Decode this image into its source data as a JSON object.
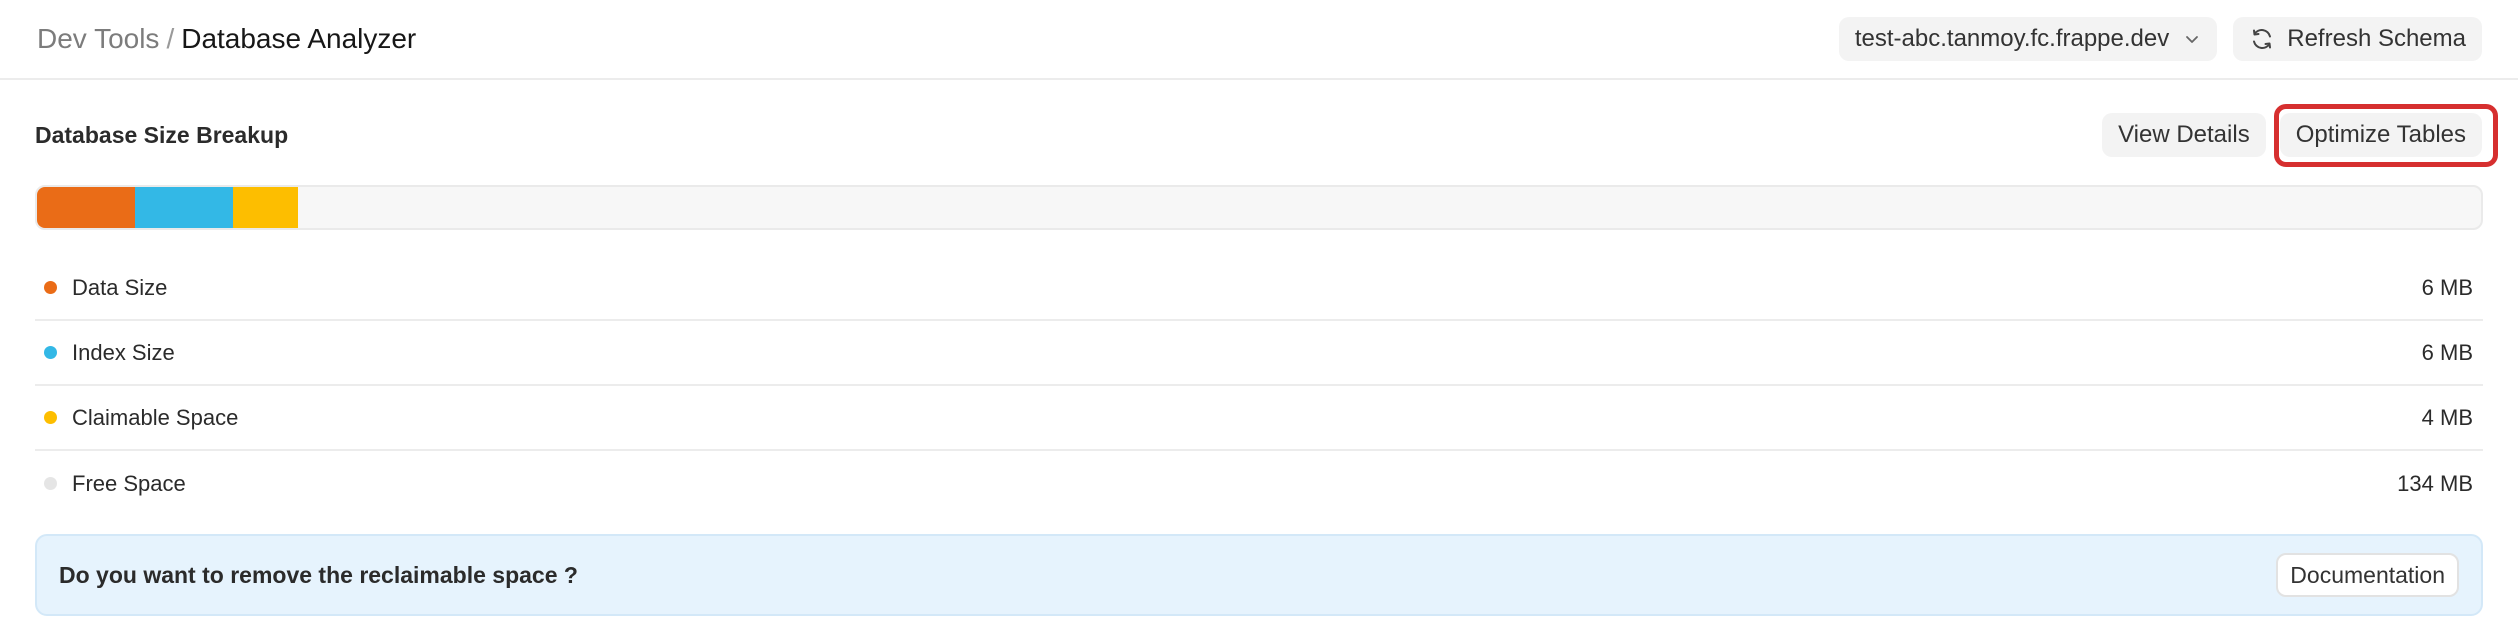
{
  "header": {
    "breadcrumb_parent": "Dev Tools",
    "breadcrumb_separator": "/",
    "breadcrumb_current": "Database Analyzer",
    "site_select": {
      "value": "test-abc.tanmoy.fc.frappe.dev",
      "icon": "chevron-down-icon"
    },
    "refresh_button": {
      "label": "Refresh Schema",
      "icon": "refresh-icon"
    }
  },
  "section": {
    "title": "Database Size Breakup",
    "view_details_label": "View Details",
    "optimize_tables_label": "Optimize Tables",
    "highlight_color": "#d62f2f"
  },
  "breakup": [
    {
      "label": "Data Size",
      "value": "6 MB",
      "mb": 6,
      "color": "#ea6c17"
    },
    {
      "label": "Index Size",
      "value": "6 MB",
      "mb": 6,
      "color": "#33b8e6"
    },
    {
      "label": "Claimable Space",
      "value": "4 MB",
      "mb": 4,
      "color": "#fdbe00"
    },
    {
      "label": "Free Space",
      "value": "134 MB",
      "mb": 134,
      "color": "#e5e5e5"
    }
  ],
  "banner": {
    "message": "Do you want to remove the reclaimable space ?",
    "documentation_label": "Documentation",
    "background_color": "#e6f3fd"
  }
}
